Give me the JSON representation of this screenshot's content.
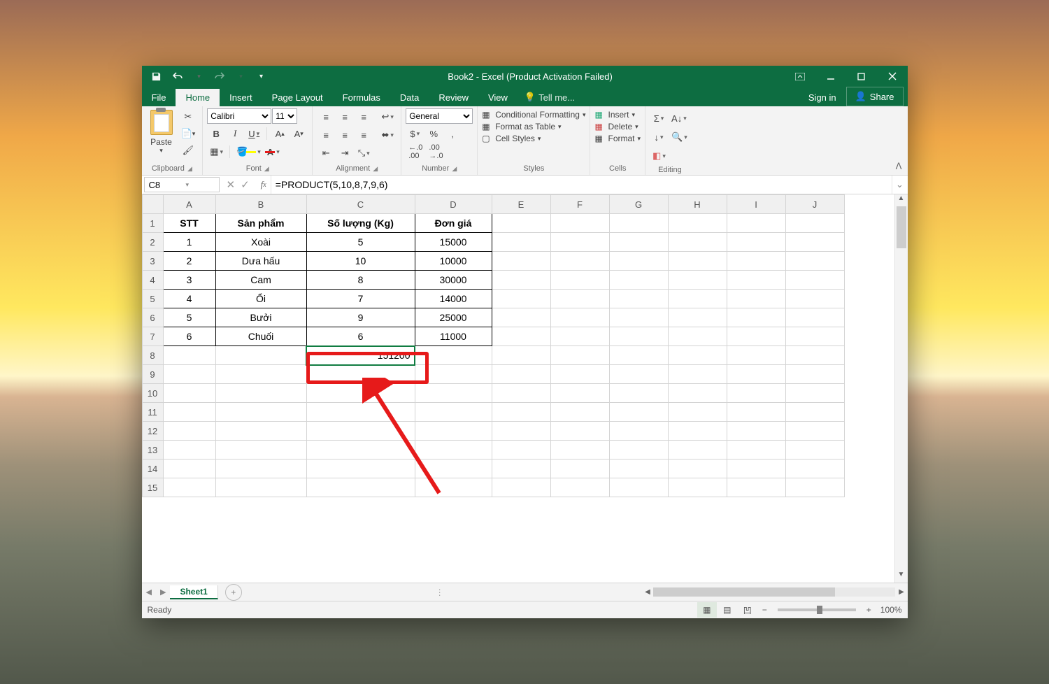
{
  "titlebar": {
    "title": "Book2 - Excel (Product Activation Failed)"
  },
  "tabs": {
    "file": "File",
    "home": "Home",
    "insert": "Insert",
    "pageLayout": "Page Layout",
    "formulas": "Formulas",
    "data": "Data",
    "review": "Review",
    "view": "View",
    "tellme": "Tell me...",
    "signin": "Sign in",
    "share": "Share"
  },
  "ribbon": {
    "clipboard": {
      "paste": "Paste",
      "label": "Clipboard"
    },
    "font": {
      "name": "Calibri",
      "size": "11",
      "label": "Font"
    },
    "alignment": {
      "label": "Alignment"
    },
    "number": {
      "format": "General",
      "label": "Number"
    },
    "styles": {
      "cond": "Conditional Formatting",
      "table": "Format as Table",
      "cell": "Cell Styles",
      "label": "Styles"
    },
    "cells": {
      "insert": "Insert",
      "delete": "Delete",
      "format": "Format",
      "label": "Cells"
    },
    "editing": {
      "label": "Editing"
    }
  },
  "formulabar": {
    "cellref": "C8",
    "formula": "=PRODUCT(5,10,8,7,9,6)"
  },
  "columns": [
    "A",
    "B",
    "C",
    "D",
    "E",
    "F",
    "G",
    "H",
    "I",
    "J"
  ],
  "rows": [
    "1",
    "2",
    "3",
    "4",
    "5",
    "6",
    "7",
    "8",
    "9",
    "10",
    "11",
    "12",
    "13",
    "14",
    "15"
  ],
  "headers": {
    "A": "STT",
    "B": "Sản phẩm",
    "C": "Số lượng (Kg)",
    "D": "Đơn giá"
  },
  "data": [
    {
      "A": "1",
      "B": "Xoài",
      "C": "5",
      "D": "15000"
    },
    {
      "A": "2",
      "B": "Dưa hấu",
      "C": "10",
      "D": "10000"
    },
    {
      "A": "3",
      "B": "Cam",
      "C": "8",
      "D": "30000"
    },
    {
      "A": "4",
      "B": "Ổi",
      "C": "7",
      "D": "14000"
    },
    {
      "A": "5",
      "B": "Bưởi",
      "C": "9",
      "D": "25000"
    },
    {
      "A": "6",
      "B": "Chuối",
      "C": "6",
      "D": "11000"
    }
  ],
  "resultCell": {
    "value": "151200"
  },
  "sheettab": "Sheet1",
  "status": {
    "ready": "Ready",
    "zoom": "100%"
  }
}
